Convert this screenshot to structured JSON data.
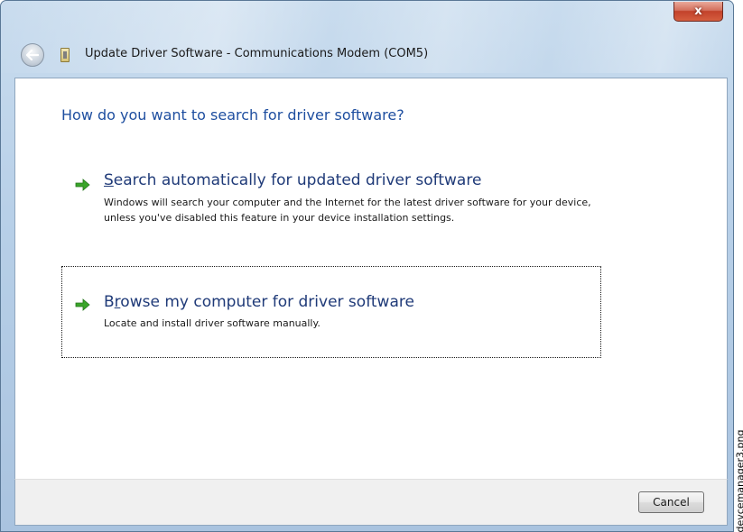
{
  "window": {
    "title": "Update Driver Software - Communications Modem (COM5)",
    "close_label": "x"
  },
  "heading": "How do you want to search for driver software?",
  "options": [
    {
      "title_access": "S",
      "title_rest": "earch automatically for updated driver software",
      "description": "Windows will search your computer and the Internet for the latest driver software for your device, unless you've disabled this feature in your device installation settings.",
      "focused": false
    },
    {
      "title_pre": "B",
      "title_access": "r",
      "title_rest": "owse my computer for driver software",
      "description": "Locate and install driver software manually.",
      "focused": true
    }
  ],
  "footer": {
    "cancel_label": "Cancel"
  },
  "side_label": "devcemanager3.png",
  "colors": {
    "heading": "#1f4fa0",
    "option_title": "#1f3a78",
    "arrow": "#3aa52a",
    "close_button": "#c2422b"
  },
  "icons": {
    "back": "back-arrow-icon",
    "title": "device-icon",
    "option_arrow": "green-arrow-icon"
  }
}
